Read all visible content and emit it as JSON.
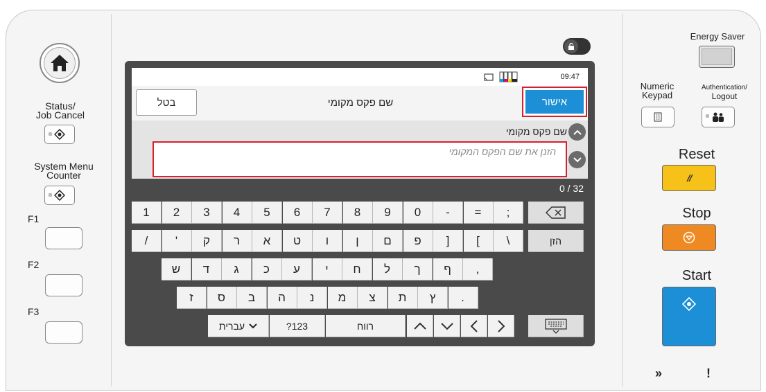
{
  "left_panel": {
    "status_job_cancel": [
      "Status/",
      "Job Cancel"
    ],
    "system_menu_counter": [
      "System Menu",
      "Counter"
    ],
    "f1": "F1",
    "f2": "F2",
    "f3": "F3"
  },
  "right_panel": {
    "energy_saver": "Energy Saver",
    "numeric_keypad": [
      "Numeric",
      "Keypad"
    ],
    "auth_logout": [
      "Authentication/",
      "Logout"
    ],
    "reset": "Reset",
    "stop": "Stop",
    "start": "Start",
    "indicator_processing_icon": "»",
    "indicator_attention_icon": "!",
    "colors": {
      "reset": "#f6c21a",
      "stop": "#ef8a23",
      "start": "#1d8fd6"
    }
  },
  "screen": {
    "time": "09:47",
    "cancel_label": "בטל",
    "title": "שם פקס מקומי",
    "ok_label": "אישור",
    "field_label": "שם פקס מקומי",
    "field_placeholder": "הזנן את שם הפקס המקומי",
    "char_counter": "0 / 32",
    "accent_color": "#1d8fd6",
    "highlight_color": "#d6202f"
  },
  "keyboard": {
    "row1": [
      "1",
      "2",
      "3",
      "4",
      "5",
      "6",
      "7",
      "8",
      "9",
      "0",
      "-",
      "=",
      ";"
    ],
    "row2": [
      "/",
      "'",
      "ק",
      "ר",
      "א",
      "ט",
      "ו",
      "ן",
      "ם",
      "פ",
      "]",
      "[",
      "\\"
    ],
    "row2_enter": "הזן",
    "row3": [
      "ש",
      "ד",
      "ג",
      "כ",
      "ע",
      "י",
      "ח",
      "ל",
      "ך",
      "ף",
      ","
    ],
    "row4": [
      "ז",
      "ס",
      "ב",
      "ה",
      "נ",
      "מ",
      "צ",
      "ת",
      "ץ",
      "."
    ],
    "language_label": "עברית",
    "symbols_label": "?123",
    "space_label": "רווח"
  }
}
